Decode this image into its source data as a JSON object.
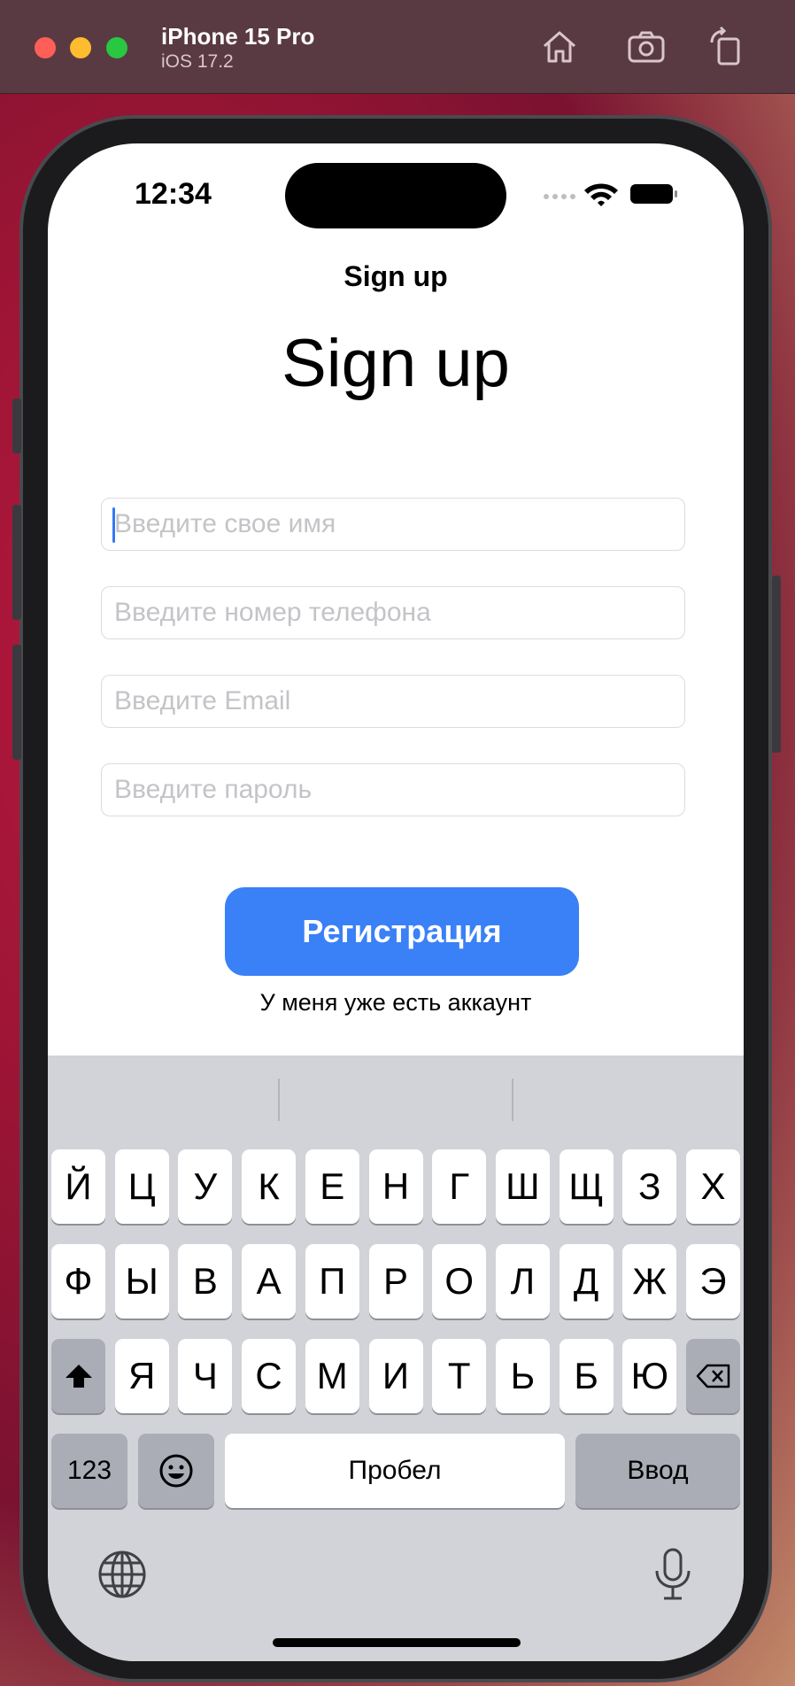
{
  "simulator": {
    "device_name": "iPhone 15 Pro",
    "os_version": "iOS 17.2",
    "buttons": [
      {
        "name": "home-icon"
      },
      {
        "name": "screenshot-icon"
      },
      {
        "name": "rotate-icon"
      }
    ]
  },
  "status_bar": {
    "time": "12:34",
    "icons": [
      "signal-dots-icon",
      "wifi-icon",
      "battery-icon"
    ]
  },
  "screen": {
    "nav_title": "Sign up",
    "title": "Sign up",
    "fields": [
      {
        "placeholder": "Введите свое имя",
        "value": "",
        "focused": true
      },
      {
        "placeholder": "Введите номер телефона",
        "value": ""
      },
      {
        "placeholder": "Введите Email",
        "value": ""
      },
      {
        "placeholder": "Введите пароль",
        "value": ""
      }
    ],
    "primary_button": "Регистрация",
    "secondary_link": "У меня уже есть аккаунт",
    "accent_color": "#3a80f7"
  },
  "keyboard": {
    "row1": [
      "Й",
      "Ц",
      "У",
      "К",
      "Е",
      "Н",
      "Г",
      "Ш",
      "Щ",
      "З",
      "Х"
    ],
    "row2": [
      "Ф",
      "Ы",
      "В",
      "А",
      "П",
      "Р",
      "О",
      "Л",
      "Д",
      "Ж",
      "Э"
    ],
    "row3": [
      "Я",
      "Ч",
      "С",
      "М",
      "И",
      "Т",
      "Ь",
      "Б",
      "Ю"
    ],
    "numbers_key": "123",
    "space_key": "Пробел",
    "return_key": "Ввод",
    "icons": [
      "shift-icon",
      "backspace-icon",
      "emoji-icon",
      "globe-icon",
      "microphone-icon"
    ]
  }
}
